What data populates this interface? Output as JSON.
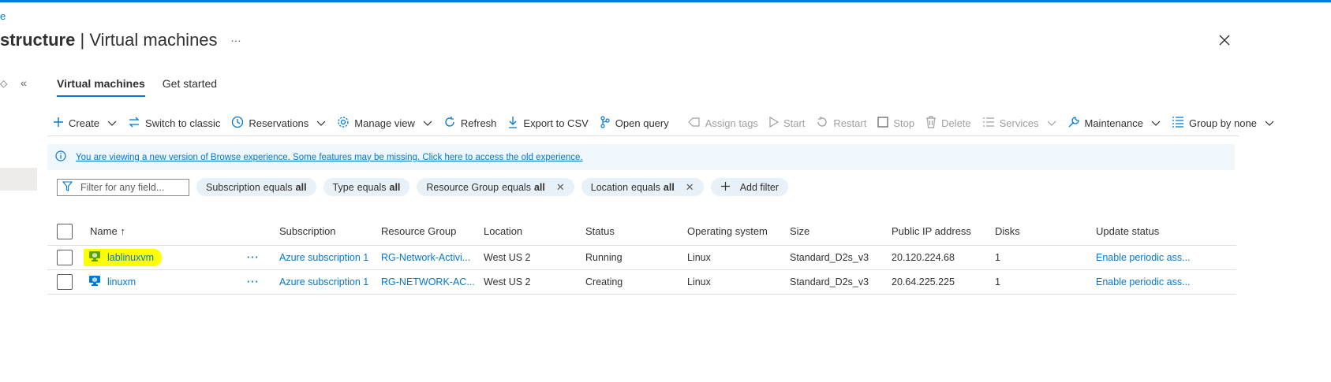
{
  "breadcrumb": {
    "label": "e"
  },
  "page": {
    "title_bold": "structure",
    "title_sep": " | ",
    "title_rest": "Virtual machines",
    "more_label": "…"
  },
  "sidebar": {
    "toggle_glyph": "◇",
    "collapse_glyph": "«"
  },
  "tabs": [
    {
      "label": "Virtual machines",
      "active": true
    },
    {
      "label": "Get started",
      "active": false
    }
  ],
  "toolbar": {
    "create": "Create",
    "switch_classic": "Switch to classic",
    "reservations": "Reservations",
    "manage_view": "Manage view",
    "refresh": "Refresh",
    "export_csv": "Export to CSV",
    "open_query": "Open query",
    "assign_tags": "Assign tags",
    "start": "Start",
    "restart": "Restart",
    "stop": "Stop",
    "delete": "Delete",
    "services": "Services",
    "maintenance": "Maintenance",
    "group_by": "Group by none"
  },
  "info_bar": {
    "text": "You are viewing a new version of Browse experience. Some features may be missing. Click here to access the old experience."
  },
  "filters": {
    "search_placeholder": "Filter for any field...",
    "pills": [
      {
        "field": "Subscription",
        "op": "equals",
        "value": "all",
        "removable": false
      },
      {
        "field": "Type",
        "op": "equals",
        "value": "all",
        "removable": false
      },
      {
        "field": "Resource Group",
        "op": "equals",
        "value": "all",
        "removable": true
      },
      {
        "field": "Location",
        "op": "equals",
        "value": "all",
        "removable": true
      }
    ],
    "add_filter": "Add filter"
  },
  "table": {
    "columns": {
      "name": "Name",
      "sort_glyph": "↑",
      "subscription": "Subscription",
      "resource_group": "Resource Group",
      "location": "Location",
      "status": "Status",
      "os": "Operating system",
      "size": "Size",
      "public_ip": "Public IP address",
      "disks": "Disks",
      "update_status": "Update status"
    },
    "rows": [
      {
        "name": "lablinuxvm",
        "highlighted": true,
        "more": "···",
        "subscription": "Azure subscription 1",
        "resource_group": "RG-Network-Activi...",
        "location": "West US 2",
        "status": "Running",
        "os": "Linux",
        "size": "Standard_D2s_v3",
        "public_ip": "20.120.224.68",
        "disks": "1",
        "update_status": "Enable periodic ass..."
      },
      {
        "name": "linuxm",
        "highlighted": false,
        "more": "···",
        "subscription": "Azure subscription 1",
        "resource_group": "RG-NETWORK-AC...",
        "location": "West US 2",
        "status": "Creating",
        "os": "Linux",
        "size": "Standard_D2s_v3",
        "public_ip": "20.64.225.225",
        "disks": "1",
        "update_status": "Enable periodic ass..."
      }
    ]
  },
  "colors": {
    "accent": "#0078d4",
    "highlight": "#ffff00",
    "vm_icon_running": "#57a300",
    "vm_icon": "#0078d4"
  },
  "icons": {
    "create": "plus-icon",
    "switch_classic": "switch-arrows-icon",
    "reservations": "clock-icon",
    "manage_view": "gear-icon",
    "refresh": "refresh-icon",
    "export": "download-icon",
    "open_query": "query-icon",
    "assign_tags": "tag-icon",
    "start": "play-icon",
    "restart": "restart-icon",
    "stop": "stop-icon",
    "delete": "trash-icon",
    "services": "list-icon",
    "maintenance": "wrench-icon",
    "group_by": "group-list-icon",
    "info": "info-icon",
    "filter": "funnel-icon",
    "vm": "virtual-machine-icon"
  }
}
